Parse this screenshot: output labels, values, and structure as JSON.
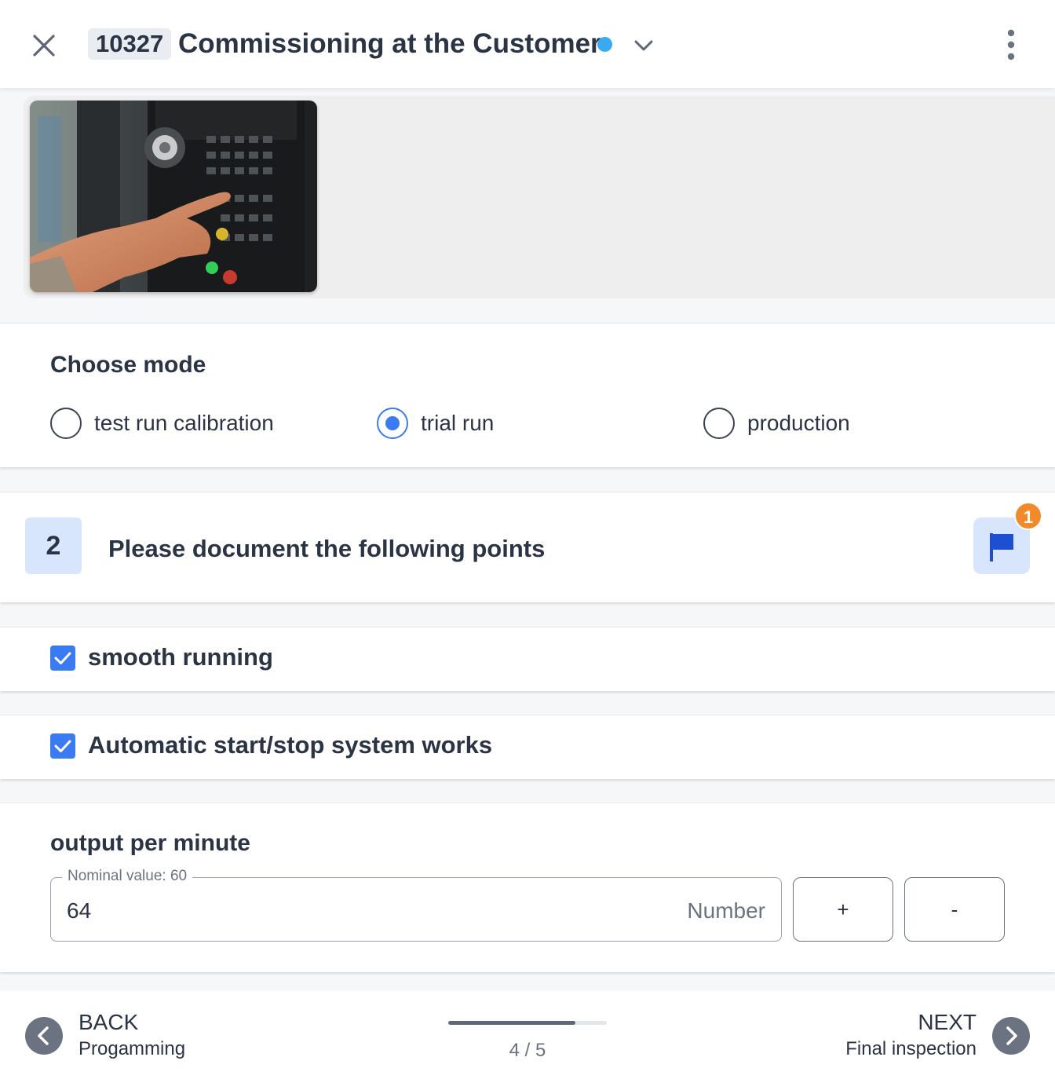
{
  "header": {
    "id": "10327",
    "title": "Commissioning at the Customer",
    "status_color": "#3aaaf0"
  },
  "icons": {
    "close": "close-icon",
    "dropdown": "chevron-down-icon",
    "more": "more-vertical-icon",
    "flag": "flag-icon",
    "back": "chevron-left-icon",
    "next": "chevron-right-icon"
  },
  "mode": {
    "title": "Choose mode",
    "options": [
      {
        "label": "test run calibration",
        "selected": false
      },
      {
        "label": "trial run",
        "selected": true
      },
      {
        "label": "production",
        "selected": false
      }
    ]
  },
  "step": {
    "number": "2",
    "title": "Please document the following points",
    "flag_badge": "1"
  },
  "checks": [
    {
      "label": "smooth running",
      "checked": true
    },
    {
      "label": "Automatic start/stop system works",
      "checked": true
    }
  ],
  "output": {
    "title": "output per minute",
    "legend": "Nominal value: 60",
    "value": "64",
    "unit": "Number",
    "plus_label": "+",
    "minus_label": "-"
  },
  "footer": {
    "back_label": "BACK",
    "back_sub": "Progamming",
    "next_label": "NEXT",
    "next_sub": "Final inspection",
    "progress_text": "4 / 5",
    "progress_fraction": 0.8
  },
  "colors": {
    "accent": "#3b7bf2",
    "flag": "#1e4fd0",
    "badge": "#f08a2a"
  }
}
